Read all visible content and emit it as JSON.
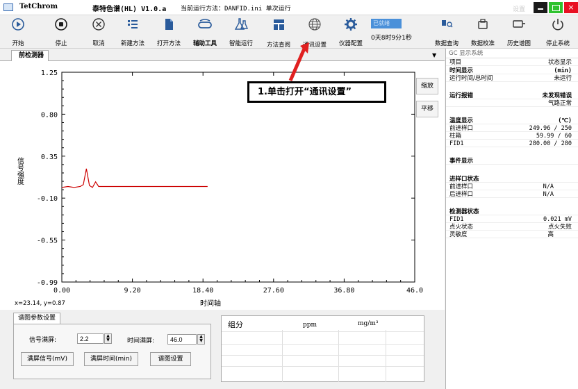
{
  "titlebar": {
    "app_name": "TetChrom",
    "app_title": "泰特色谱(HL) V1.0.a",
    "method": "当前运行方法：DANFID.ini 单次运行",
    "settings": "设置",
    "close": "×"
  },
  "toolbar": {
    "start": "开始",
    "stop": "停止",
    "cancel": "取消",
    "new_method": "新建方法",
    "open_method": "打开方法",
    "aux_tools": "辅助工具",
    "smart_run": "智能运行",
    "method_query": "方法查阅",
    "comm_settings": "通讯设置",
    "instrument_config": "仪器配置",
    "status": "已就绪",
    "run_time": "0天8时9分1秒",
    "data_query": "数据查询",
    "data_calibration": "数据校准",
    "history_chart": "历史谱图",
    "shutdown": "停止系统"
  },
  "tab": {
    "label": "前检测器"
  },
  "chart_data": {
    "type": "line",
    "ylabel": "信号强度",
    "xlabel": "时间轴",
    "ylim": [
      -0.99,
      1.25
    ],
    "xlim": [
      0.0,
      46.0
    ],
    "yticks": [
      "1.25",
      "0.80",
      "0.35",
      "-0.10",
      "-0.55",
      "-0.99"
    ],
    "xticks": [
      "0.00",
      "9.20",
      "18.40",
      "27.60",
      "36.80",
      "46.0"
    ],
    "series": [
      {
        "color": "#cc0000",
        "x": [
          0.0,
          0.8,
          1.6,
          2.4,
          2.8,
          3.2,
          3.6,
          4.0,
          4.4,
          4.8,
          5.2,
          6.0,
          7.0,
          8.0,
          9.0,
          10.0,
          11.0,
          12.0,
          13.0,
          14.0,
          15.0,
          16.0,
          17.0,
          18.0,
          19.0
        ],
        "y": [
          0.02,
          0.03,
          0.02,
          0.03,
          0.05,
          0.22,
          0.04,
          0.02,
          0.08,
          0.03,
          0.03,
          0.03,
          0.03,
          0.03,
          0.03,
          0.03,
          0.03,
          0.03,
          0.03,
          0.03,
          0.03,
          0.03,
          0.03,
          0.03,
          0.03
        ]
      }
    ]
  },
  "coords": "x=23.14, y=0.87",
  "side_buttons": {
    "zoom": "缩放",
    "pan": "平移"
  },
  "callout": "1.单击打开“通讯设置”",
  "params": {
    "tab": "谱图参数设置",
    "signal_full_label": "信号满屏:",
    "signal_full_value": "2.2",
    "time_full_label": "时间满屏:",
    "time_full_value": "46.0",
    "btn_full_signal": "满屏信号(mV)",
    "btn_full_time": "满屏时间(min)",
    "btn_chart_settings": "谱图设置"
  },
  "component_table": {
    "col1": "组分",
    "col2": "ppm",
    "col3": "mg/m³"
  },
  "right_panel": {
    "title": "GC 显示系统",
    "header_item": "项目",
    "header_status": "状态显示",
    "time_display": "时间显示",
    "time_unit": "(min)",
    "run_time_label": "运行时间/总时间",
    "run_time_value": "未运行",
    "run_error": "运行报错",
    "run_error_value": "未发现错误",
    "gas_status": "气路正常",
    "temp_display": "温度显示",
    "temp_unit": "(℃)",
    "front_inlet": "前进样口",
    "front_inlet_value": "249.96 / 250",
    "column_oven": "柱箱",
    "column_oven_value": "59.99 / 60",
    "fid1": "FID1",
    "fid1_value": "280.00 / 280",
    "event_display": "事件显示",
    "inlet_status": "进样口状态",
    "front_inlet2": "前进样口",
    "front_inlet2_value": "N/A",
    "rear_inlet": "后进样口",
    "rear_inlet_value": "N/A",
    "detector_status": "检测器状态",
    "fid1_signal": "FID1",
    "fid1_signal_value": "0.021 mV",
    "ignition_status": "点火状态",
    "ignition_value": "点火失败",
    "sensitivity": "灵敏度",
    "sensitivity_value": "高"
  }
}
